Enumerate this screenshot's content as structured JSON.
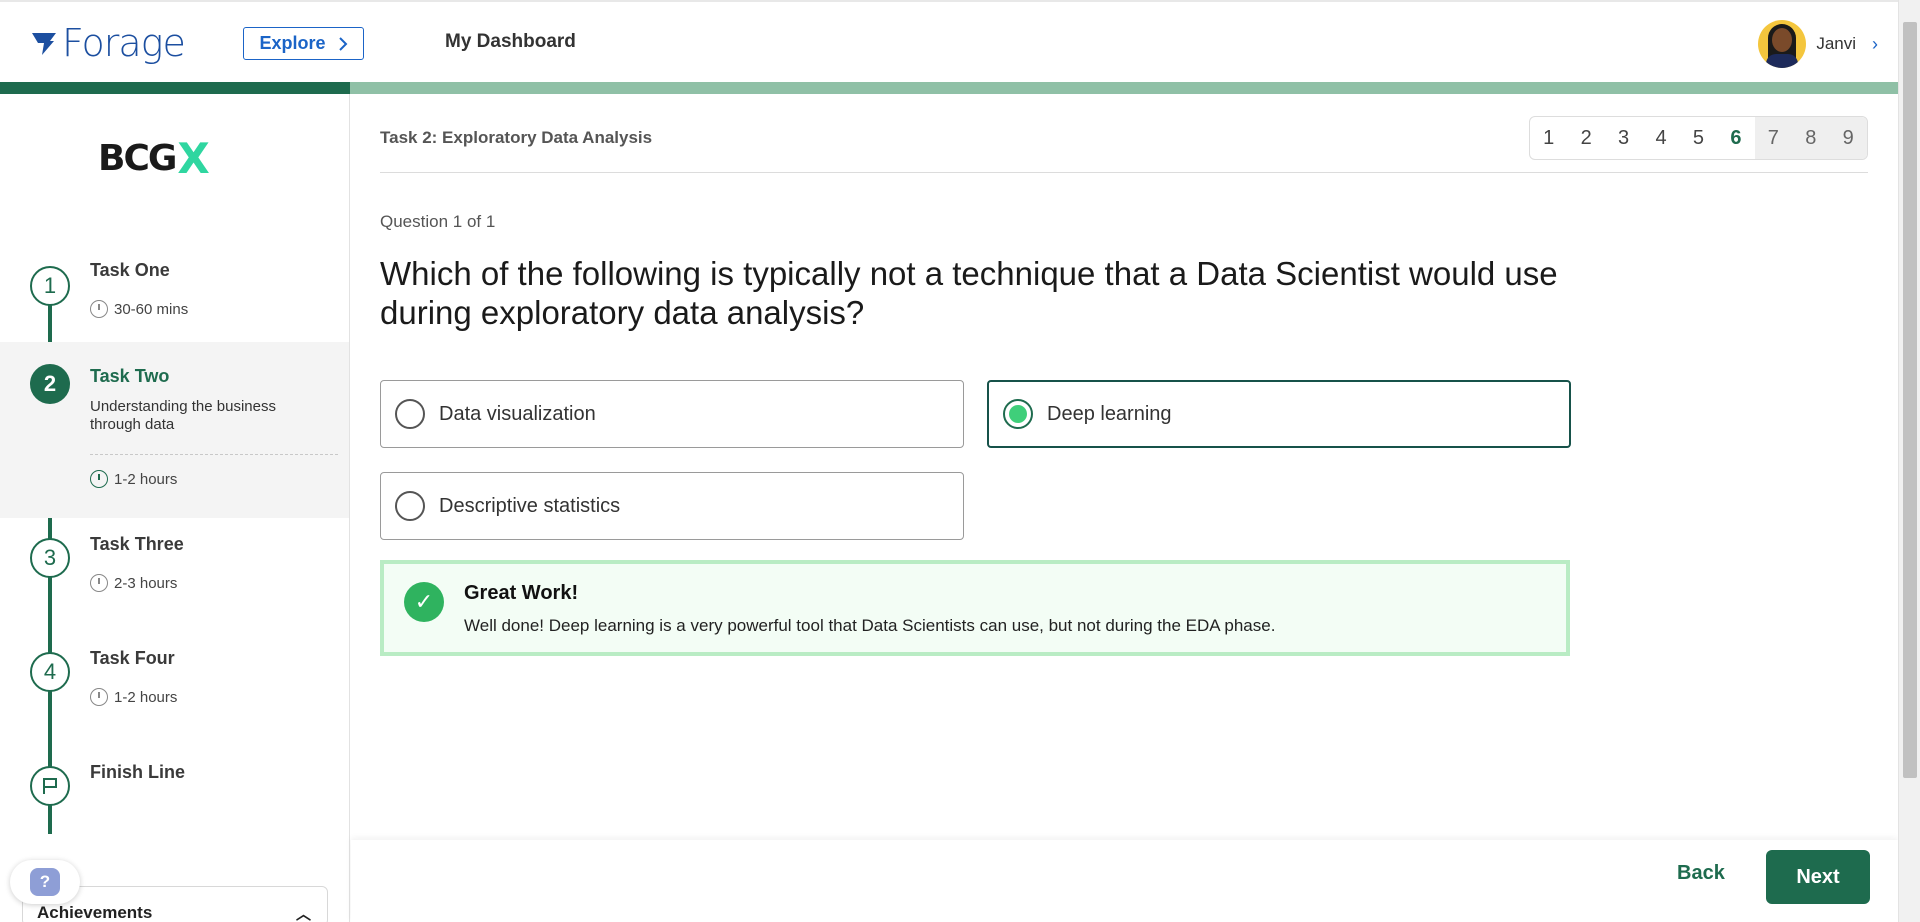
{
  "header": {
    "logo_text": "Forage",
    "explore_label": "Explore",
    "dashboard_label": "My Dashboard",
    "user_name": "Janvi"
  },
  "sidebar": {
    "company_logo_text": "BCG",
    "company_logo_mark": "X",
    "tasks": [
      {
        "number": "1",
        "title": "Task One",
        "duration": "30-60 mins"
      },
      {
        "number": "2",
        "title": "Task Two",
        "description": "Understanding the business through data",
        "duration": "1-2 hours"
      },
      {
        "number": "3",
        "title": "Task Three",
        "duration": "2-3 hours"
      },
      {
        "number": "4",
        "title": "Task Four",
        "duration": "1-2 hours"
      },
      {
        "title": "Finish Line"
      }
    ],
    "help_label": "?",
    "achievements_label": "Achievements"
  },
  "main": {
    "task_heading": "Task 2: Exploratory Data Analysis",
    "pages": [
      "1",
      "2",
      "3",
      "4",
      "5",
      "6",
      "7",
      "8",
      "9"
    ],
    "current_page": "6",
    "question_counter": "Question 1 of 1",
    "question": "Which of the following is typically not a technique that a Data Scientist would use during exploratory data analysis?",
    "options": [
      {
        "label": "Data visualization",
        "selected": false
      },
      {
        "label": "Deep learning",
        "selected": true
      },
      {
        "label": "Descriptive statistics",
        "selected": false
      }
    ],
    "feedback": {
      "title": "Great Work!",
      "text": "Well done! Deep learning is a very powerful tool that Data Scientists can use, but not during the EDA phase."
    },
    "back_label": "Back",
    "next_label": "Next"
  },
  "colors": {
    "brand_green": "#1e6b4e",
    "light_green": "#8fc0a6",
    "forage_blue": "#1c4fa0",
    "success_green": "#2fb35f",
    "bcg_accent": "#2fd6a0"
  }
}
